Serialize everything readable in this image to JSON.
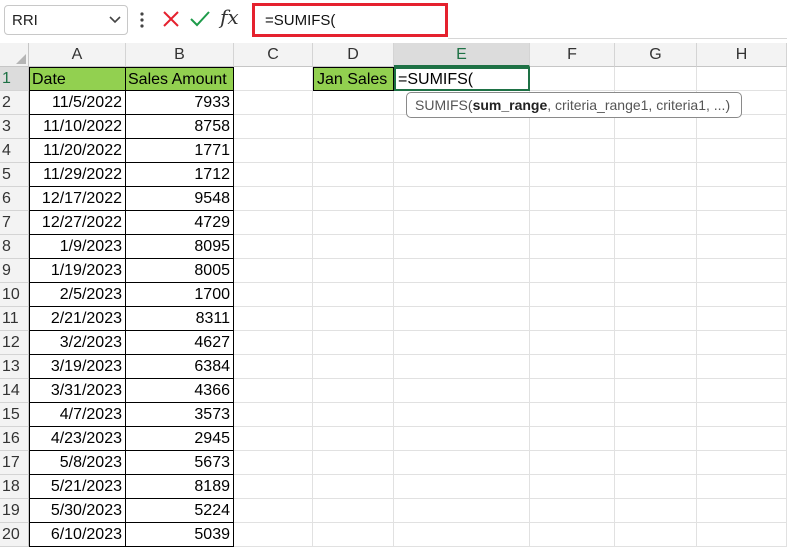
{
  "name_box": {
    "value": "RRI"
  },
  "formula_bar": {
    "fx_label": "fx",
    "formula": "=SUMIFS("
  },
  "columns": [
    "A",
    "B",
    "C",
    "D",
    "E",
    "F",
    "G",
    "H"
  ],
  "active": {
    "column": "E",
    "row": "1"
  },
  "rows": [
    "1",
    "2",
    "3",
    "4",
    "5",
    "6",
    "7",
    "8",
    "9",
    "10",
    "11",
    "12",
    "13",
    "14",
    "15",
    "16",
    "17",
    "18",
    "19",
    "20"
  ],
  "table": {
    "headers": [
      "Date",
      "Sales Amount"
    ],
    "dates": [
      "11/5/2022",
      "11/10/2022",
      "11/20/2022",
      "11/29/2022",
      "12/17/2022",
      "12/27/2022",
      "1/9/2023",
      "1/19/2023",
      "2/5/2023",
      "2/21/2023",
      "3/2/2023",
      "3/19/2023",
      "3/31/2023",
      "4/7/2023",
      "4/23/2023",
      "5/8/2023",
      "5/21/2023",
      "5/30/2023",
      "6/10/2023"
    ],
    "amounts": [
      "7933",
      "8758",
      "1771",
      "1712",
      "9548",
      "4729",
      "8095",
      "8005",
      "1700",
      "8311",
      "4627",
      "6384",
      "4366",
      "3573",
      "2945",
      "5673",
      "8189",
      "5224",
      "5039"
    ]
  },
  "d1_label": "Jan Sales",
  "e1_value": "=SUMIFS(",
  "tooltip": {
    "func": "SUMIFS(",
    "bold_arg": "sum_range",
    "rest": ", criteria_range1, criteria1, ...)"
  },
  "colors": {
    "green_fill": "#92d050",
    "excel_green": "#1e7145",
    "highlight_red": "#e5212e"
  }
}
